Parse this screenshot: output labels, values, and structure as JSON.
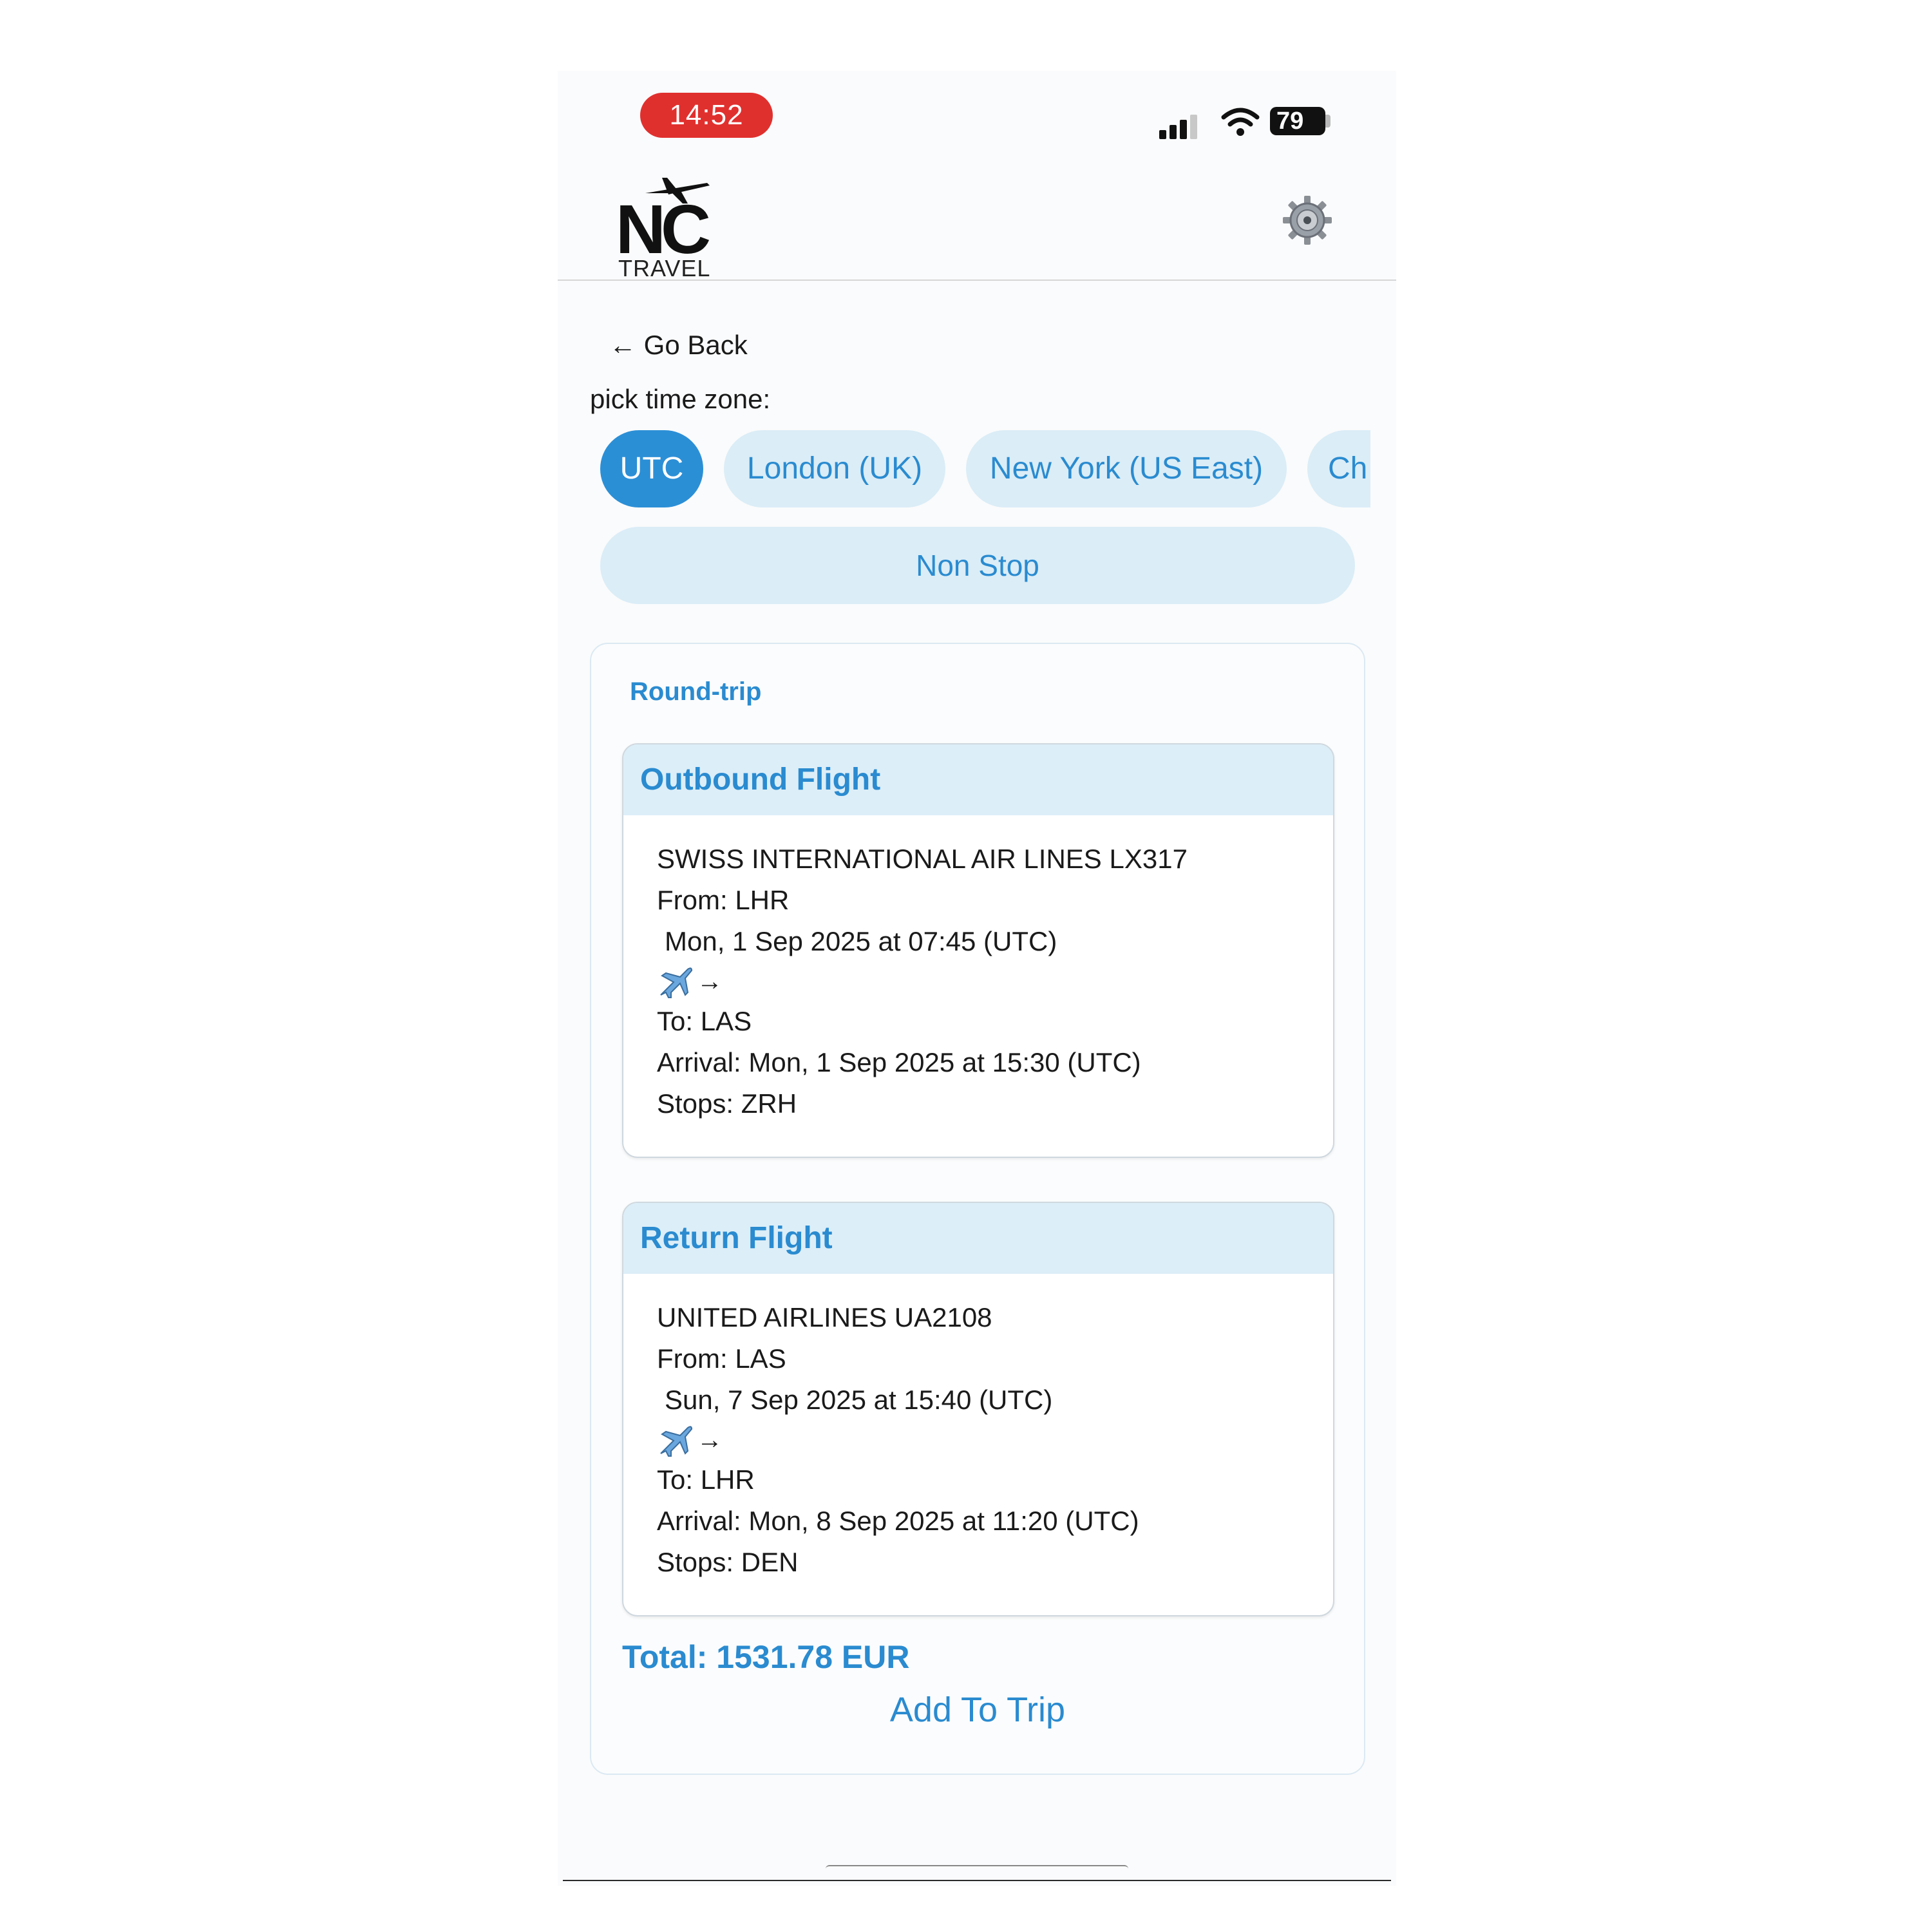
{
  "status_bar": {
    "time": "14:52",
    "battery": "79"
  },
  "header": {
    "logo_mark": "NC",
    "logo_sub": "TRAVEL"
  },
  "nav": {
    "go_back": "← Go Back"
  },
  "timezone": {
    "label": "pick time zone:",
    "options": [
      "UTC",
      "London (UK)",
      "New York (US East)",
      "Ch"
    ],
    "selected": "UTC"
  },
  "filter": {
    "non_stop": "Non Stop"
  },
  "result": {
    "trip_type": "Round-trip",
    "outbound": {
      "title": "Outbound Flight",
      "airline_flight": "SWISS INTERNATIONAL AIR LINES LX317",
      "from": "From: LHR",
      "departure": "Mon, 1 Sep 2025 at 07:45 (UTC)",
      "arrow": "→",
      "to": "To: LAS",
      "arrival": "Arrival: Mon, 1 Sep 2025 at 15:30 (UTC)",
      "stops": "Stops: ZRH"
    },
    "return": {
      "title": "Return Flight",
      "airline_flight": "UNITED AIRLINES UA2108",
      "from": "From: LAS",
      "departure": "Sun, 7 Sep 2025 at 15:40 (UTC)",
      "arrow": "→",
      "to": "To: LHR",
      "arrival": "Arrival: Mon, 8 Sep 2025 at 11:20 (UTC)",
      "stops": "Stops: DEN"
    },
    "total": "Total: 1531.78 EUR",
    "add_button": "Add To Trip"
  },
  "colors": {
    "accent": "#2b8fd6",
    "chip_bg": "#dbedf7",
    "time_pill": "#e0302e"
  },
  "icons": [
    "signal-icon",
    "wifi-icon",
    "battery-icon",
    "gear-icon",
    "airplane-icon",
    "arrow-right-icon",
    "arrow-left-icon"
  ]
}
